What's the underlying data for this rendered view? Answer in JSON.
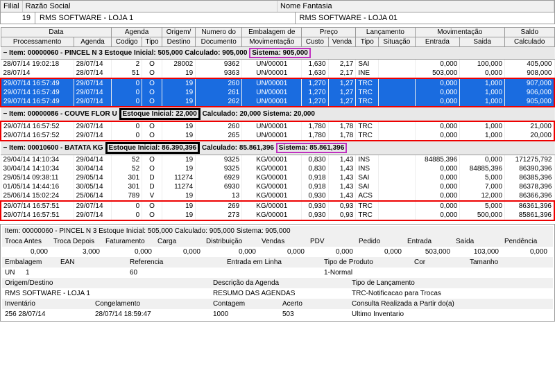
{
  "top": {
    "filial_label": "Filial",
    "razao_label": "Razão Social",
    "nome_label": "Nome Fantasia",
    "filial_num": "19",
    "razao_value": "RMS SOFTWARE - LOJA 1",
    "fantasia_value": "RMS SOFTWARE - LOJA 01"
  },
  "headers": {
    "data": "Data",
    "agenda": "Agenda",
    "origem": "Origem/",
    "numero": "Numero do",
    "embalagem": "Embalagem de",
    "preco": "Preço",
    "lancamento": "Lançamento",
    "movimentacao": "Movimentação",
    "saldo": "Saldo",
    "processamento": "Processamento",
    "agenda2": "Agenda",
    "codigo": "Codigo",
    "tipo": "Tipo",
    "destino": "Destino",
    "documento": "Documento",
    "mov2": "Movimentação",
    "custo": "Custo",
    "venda": "Venda",
    "tipo2": "Tipo",
    "situacao": "Situação",
    "entrada": "Entrada",
    "saida": "Saida",
    "calculado": "Calculado"
  },
  "section1": {
    "prefix": "−  Item: 00000060 - PINCEL N 3  Estoque Inicial: 505,000  Calculado: 905,000",
    "sistema": "Sistema: 905,000"
  },
  "rows1": [
    {
      "proc": "28/07/14 19:02:18",
      "ag": "28/07/14",
      "cod": "2",
      "tp": "O",
      "dest": "28002",
      "doc": "9362",
      "mov": "UN/00001",
      "cus": "1,630",
      "ven": "2,17",
      "ltp": "SAI",
      "sit": "",
      "ent": "0,000",
      "sai": "100,000",
      "calc": "405,000",
      "cls": ""
    },
    {
      "proc": "28/07/14",
      "ag": "28/07/14",
      "cod": "51",
      "tp": "O",
      "dest": "19",
      "doc": "9363",
      "mov": "UN/00001",
      "cus": "1,630",
      "ven": "2,17",
      "ltp": "INE",
      "sit": "",
      "ent": "503,000",
      "sai": "0,000",
      "calc": "908,000",
      "cls": ""
    },
    {
      "proc": "29/07/14 16:57:49",
      "ag": "29/07/14",
      "cod": "0",
      "tp": "O",
      "dest": "19",
      "doc": "260",
      "mov": "UN/00001",
      "cus": "1,270",
      "ven": "1,27",
      "ltp": "TRC",
      "sit": "",
      "ent": "0,000",
      "sai": "1,000",
      "calc": "907,000",
      "cls": "blue-row"
    },
    {
      "proc": "29/07/14 16:57:49",
      "ag": "29/07/14",
      "cod": "0",
      "tp": "O",
      "dest": "19",
      "doc": "261",
      "mov": "UN/00001",
      "cus": "1,270",
      "ven": "1,27",
      "ltp": "TRC",
      "sit": "",
      "ent": "0,000",
      "sai": "1,000",
      "calc": "906,000",
      "cls": "blue-row"
    },
    {
      "proc": "29/07/14 16:57:49",
      "ag": "29/07/14",
      "cod": "0",
      "tp": "O",
      "dest": "19",
      "doc": "262",
      "mov": "UN/00001",
      "cus": "1,270",
      "ven": "1,27",
      "ltp": "TRC",
      "sit": "",
      "ent": "0,000",
      "sai": "1,000",
      "calc": "905,000",
      "cls": "blue-row"
    }
  ],
  "section2": {
    "prefix": "−  Item: 00000086 - COUVE FLOR U",
    "estoque": "Estoque Inicial: 22,000",
    "middle": "Calculado: 20,000",
    "sistema": "Sistema: 20,000"
  },
  "rows2": [
    {
      "proc": "29/07/14 16:57:52",
      "ag": "29/07/14",
      "cod": "0",
      "tp": "O",
      "dest": "19",
      "doc": "260",
      "mov": "UN/00001",
      "cus": "1,780",
      "ven": "1,78",
      "ltp": "TRC",
      "sit": "",
      "ent": "0,000",
      "sai": "1,000",
      "calc": "21,000"
    },
    {
      "proc": "29/07/14 16:57:52",
      "ag": "29/07/14",
      "cod": "0",
      "tp": "O",
      "dest": "19",
      "doc": "265",
      "mov": "UN/00001",
      "cus": "1,780",
      "ven": "1,78",
      "ltp": "TRC",
      "sit": "",
      "ent": "0,000",
      "sai": "1,000",
      "calc": "20,000"
    }
  ],
  "section3": {
    "prefix": "−  Item: 00010600 - BATATA KG",
    "estoque": "Estoque Inicial: 86.390,396",
    "middle": "Calculado: 85.861,396",
    "sistema": "Sistema: 85.861,396"
  },
  "rows3a": [
    {
      "proc": "29/04/14 14:10:34",
      "ag": "29/04/14",
      "cod": "52",
      "tp": "O",
      "dest": "19",
      "doc": "9325",
      "mov": "KG/00001",
      "cus": "0,830",
      "ven": "1,43",
      "ltp": "INS",
      "sit": "",
      "ent": "84885,396",
      "sai": "0,000",
      "calc": "171275,792"
    },
    {
      "proc": "30/04/14 14:10:34",
      "ag": "30/04/14",
      "cod": "52",
      "tp": "O",
      "dest": "19",
      "doc": "9325",
      "mov": "KG/00001",
      "cus": "0,830",
      "ven": "1,43",
      "ltp": "INS",
      "sit": "",
      "ent": "0,000",
      "sai": "84885,396",
      "calc": "86390,396"
    },
    {
      "proc": "29/05/14 09:38:11",
      "ag": "29/05/14",
      "cod": "301",
      "tp": "D",
      "dest": "11274",
      "doc": "6929",
      "mov": "KG/00001",
      "cus": "0,918",
      "ven": "1,43",
      "ltp": "SAI",
      "sit": "",
      "ent": "0,000",
      "sai": "5,000",
      "calc": "86385,396"
    },
    {
      "proc": "01/05/14 14:44:16",
      "ag": "30/05/14",
      "cod": "301",
      "tp": "D",
      "dest": "11274",
      "doc": "6930",
      "mov": "KG/00001",
      "cus": "0,918",
      "ven": "1,43",
      "ltp": "SAI",
      "sit": "",
      "ent": "0,000",
      "sai": "7,000",
      "calc": "86378,396"
    },
    {
      "proc": "25/06/14 15:02:24",
      "ag": "25/06/14",
      "cod": "789",
      "tp": "V",
      "dest": "19",
      "doc": "13",
      "mov": "KG/00001",
      "cus": "0,930",
      "ven": "1,43",
      "ltp": "ACS",
      "sit": "",
      "ent": "0,000",
      "sai": "12,000",
      "calc": "86366,396"
    }
  ],
  "rows3b": [
    {
      "proc": "29/07/14 16:57:51",
      "ag": "29/07/14",
      "cod": "0",
      "tp": "O",
      "dest": "19",
      "doc": "269",
      "mov": "KG/00001",
      "cus": "0,930",
      "ven": "0,93",
      "ltp": "TRC",
      "sit": "",
      "ent": "0,000",
      "sai": "5,000",
      "calc": "86361,396"
    },
    {
      "proc": "29/07/14 16:57:51",
      "ag": "29/07/14",
      "cod": "0",
      "tp": "O",
      "dest": "19",
      "doc": "273",
      "mov": "KG/00001",
      "cus": "0,930",
      "ven": "0,93",
      "ltp": "TRC",
      "sit": "",
      "ent": "0,000",
      "sai": "500,000",
      "calc": "85861,396"
    }
  ],
  "bottom": {
    "item_line": "Item: 00000060 - PINCEL N 3  Estoque Inicial: 505,000  Calculado: 905,000  Sistema: 905,000",
    "h": {
      "troca_antes": "Troca Antes",
      "troca_depois": "Troca Depois",
      "faturamento": "Faturamento",
      "carga": "Carga",
      "distribuicao": "Distribuição",
      "vendas": "Vendas",
      "pdv": "PDV",
      "pedido": "Pedido",
      "entrada": "Entrada",
      "saida": "Saída",
      "pendencia": "Pendência"
    },
    "v": {
      "troca_antes": "0,000",
      "troca_depois": "3,000",
      "faturamento": "0,000",
      "carga": "0,000",
      "distribuicao": "0,000",
      "vendas": "0,000",
      "pdv": "0,000",
      "pedido": "0,000",
      "entrada": "503,000",
      "saida": "103,000",
      "pendencia": "0,000"
    },
    "l3": {
      "embalagem": "Embalagem",
      "ean": "EAN",
      "referencia": "Referencia",
      "entrada_linha": "Entrada em Linha",
      "tipo_produto": "Tipo de Produto",
      "cor": "Cor",
      "tamanho": "Tamanho"
    },
    "l4": {
      "un": "UN",
      "un_val": "1",
      "ref_val": "60",
      "tipo_val": "1-Normal"
    },
    "l5": {
      "origem_destino": "Origem/Destino",
      "descricao": "Descrição da Agenda",
      "tipo_lanc": "Tipo de Lançamento"
    },
    "l6": {
      "origem_val": "RMS SOFTWARE - LOJA 1",
      "desc_val": "RESUMO DAS AGENDAS",
      "tipo_val": "TRC-Notificacao para Trocas"
    },
    "l7": {
      "inventario": "Inventário",
      "congelamento": "Congelamento",
      "contagem": "Contagem",
      "acerto": "Acerto",
      "consulta": "Consulta Realizada a Partir do(a)"
    },
    "l8": {
      "inv_val": "256 28/07/14",
      "cong_val": "28/07/14 18:59:47",
      "cont_val": "1000",
      "acerto_val": "503",
      "ult": "Ultimo Inventario"
    }
  }
}
